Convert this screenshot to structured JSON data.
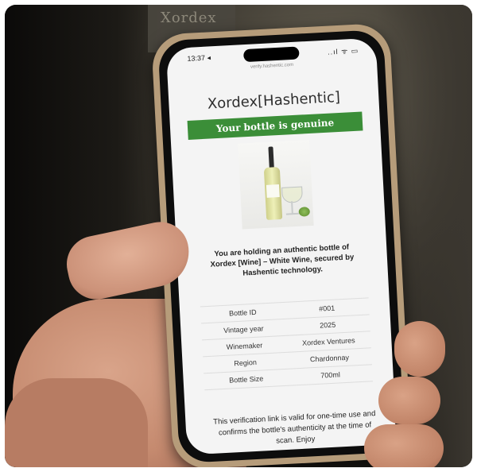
{
  "background": {
    "box_text": "Xordex"
  },
  "phone": {
    "status": {
      "time": "13:37 ◂",
      "icons": "..ıl ᯤ ▭"
    },
    "url": "verify.hashentic.com",
    "brand": "Xordex[Hashentic]",
    "banner": "Your bottle is genuine",
    "description": "You are holding an authentic bottle of Xordex [Wine] – White Wine, secured by Hashentic technology.",
    "specs": [
      {
        "label": "Bottle ID",
        "value": "#001"
      },
      {
        "label": "Vintage year",
        "value": "2025"
      },
      {
        "label": "Winemaker",
        "value": "Xordex Ventures"
      },
      {
        "label": "Region",
        "value": "Chardonnay"
      },
      {
        "label": "Bottle Size",
        "value": "700ml"
      }
    ],
    "note": "This verification link is valid for one-time use and confirms the bottle's authenticity at the time of scan. Enjoy"
  },
  "colors": {
    "banner_green": "#3b8e38",
    "phone_frame": "#b69c7a",
    "screen_bg": "#f4f4f4"
  }
}
